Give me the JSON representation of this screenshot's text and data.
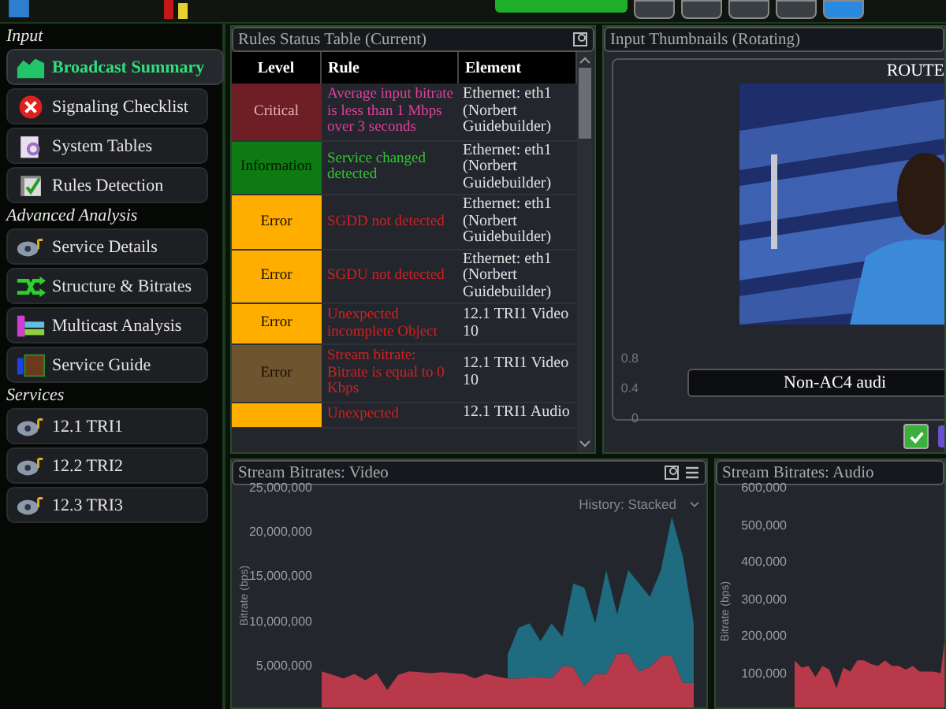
{
  "sidebar": {
    "sections": [
      {
        "title": "Input",
        "items": [
          {
            "label": "Broadcast Summary",
            "selected": true
          },
          {
            "label": "Signaling Checklist",
            "selected": false
          },
          {
            "label": "System Tables",
            "selected": false
          },
          {
            "label": "Rules Detection",
            "selected": false
          }
        ]
      },
      {
        "title": "Advanced Analysis",
        "items": [
          {
            "label": "Service Details",
            "selected": false
          },
          {
            "label": "Structure & Bitrates",
            "selected": false
          },
          {
            "label": "Multicast Analysis",
            "selected": false
          },
          {
            "label": "Service Guide",
            "selected": false
          }
        ]
      },
      {
        "title": "Services",
        "items": [
          {
            "label": "12.1 TRI1",
            "selected": false
          },
          {
            "label": "12.2 TRI2",
            "selected": false
          },
          {
            "label": "12.3 TRI3",
            "selected": false
          }
        ]
      }
    ]
  },
  "rules_table": {
    "title": "Rules Status Table (Current)",
    "columns": [
      "Level",
      "Rule",
      "Element"
    ],
    "rows": [
      {
        "level": "Critical",
        "kind": "critical",
        "color": "#6e1f26",
        "rule": "Average input bitrate is less than 1 Mbps over 3 seconds",
        "element": "Ethernet: eth1 (Norbert Guidebuilder)"
      },
      {
        "level": "Information",
        "kind": "info",
        "color": "#0e7a12",
        "rule": "Service changed detected",
        "element": "Ethernet: eth1 (Norbert Guidebuilder)"
      },
      {
        "level": "Error",
        "kind": "error",
        "color": "#ffae00",
        "rule": "SGDD not detected",
        "element": "Ethernet: eth1 (Norbert Guidebuilder)"
      },
      {
        "level": "Error",
        "kind": "error",
        "color": "#ffae00",
        "rule": "SGDU not detected",
        "element": "Ethernet: eth1 (Norbert Guidebuilder)"
      },
      {
        "level": "Error",
        "kind": "error",
        "color": "#ffae00",
        "rule": "Unexpected incomplete Object",
        "element": "12.1 TRI1 Video 10"
      },
      {
        "level": "Error",
        "kind": "error",
        "color": "#6e5530",
        "rule": "Stream bitrate: Bitrate is equal to 0 Kbps",
        "element": "12.1 TRI1 Video 10"
      },
      {
        "kind": "error",
        "color": "#ffae00",
        "rule": "Unexpected",
        "element": "12.1 TRI1 Audio"
      }
    ]
  },
  "thumbnails": {
    "title": "Input Thumbnails (Rotating)",
    "route": "ROUTE",
    "axis_labels": [
      "0.8",
      "0.4",
      "0"
    ],
    "banner": "Non-AC4 audi",
    "checked": true
  },
  "video_chart": {
    "title": "Stream Bitrates: Video",
    "history": "History: Stacked",
    "chart_data": {
      "type": "area",
      "stacked": true,
      "ylabel": "Bitrate (bps)",
      "ylim": [
        0,
        25000000
      ],
      "yticks": [
        {
          "value": 5000000,
          "label": "5,000,000"
        },
        {
          "value": 10000000,
          "label": "10,000,000"
        },
        {
          "value": 15000000,
          "label": "15,000,000"
        },
        {
          "value": 20000000,
          "label": "20,000,000"
        },
        {
          "value": 25000000,
          "label": "25,000,000"
        }
      ],
      "series": [
        {
          "color": "#b8394a",
          "values": [
            4600000,
            4200000,
            3800000,
            4300000,
            3600000,
            4400000,
            2500000,
            4200000,
            4600000,
            4500000,
            4400000,
            4500000,
            4400000,
            4300000,
            3800000,
            4300000,
            4000000,
            3800000,
            3800000,
            3900000,
            3900000,
            3800000,
            5200000,
            5100000,
            2900000,
            4300000,
            4300000,
            6600000,
            6600000,
            4600000,
            5100000,
            6300000,
            6300000,
            3300000,
            3300000
          ]
        },
        {
          "color": "#1f6b80",
          "values": [
            null,
            null,
            null,
            null,
            null,
            null,
            null,
            null,
            null,
            null,
            null,
            null,
            null,
            null,
            null,
            null,
            null,
            2700000,
            5700000,
            6100000,
            4100000,
            6200000,
            3300000,
            9400000,
            11100000,
            5700000,
            11700000,
            4400000,
            9400000,
            9900000,
            7900000,
            9700000,
            15700000,
            14200000,
            6700000
          ]
        }
      ]
    }
  },
  "audio_chart": {
    "title": "Stream Bitrates: Audio",
    "chart_data": {
      "type": "area",
      "ylabel": "Bitrate (bps)",
      "ylim": [
        0,
        600000
      ],
      "yticks": [
        {
          "value": 100000,
          "label": "100,000"
        },
        {
          "value": 200000,
          "label": "200,000"
        },
        {
          "value": 300000,
          "label": "300,000"
        },
        {
          "value": 400000,
          "label": "400,000"
        },
        {
          "value": 500000,
          "label": "500,000"
        },
        {
          "value": 600000,
          "label": "600,000"
        }
      ],
      "series": [
        {
          "color": "#b8394a",
          "values": [
            140000,
            120000,
            125000,
            95000,
            125000,
            115000,
            65000,
            120000,
            110000,
            140000,
            140000,
            130000,
            125000,
            140000,
            125000,
            125000,
            115000,
            125000,
            110000,
            110000,
            110000,
            105000,
            260000
          ]
        }
      ]
    }
  }
}
